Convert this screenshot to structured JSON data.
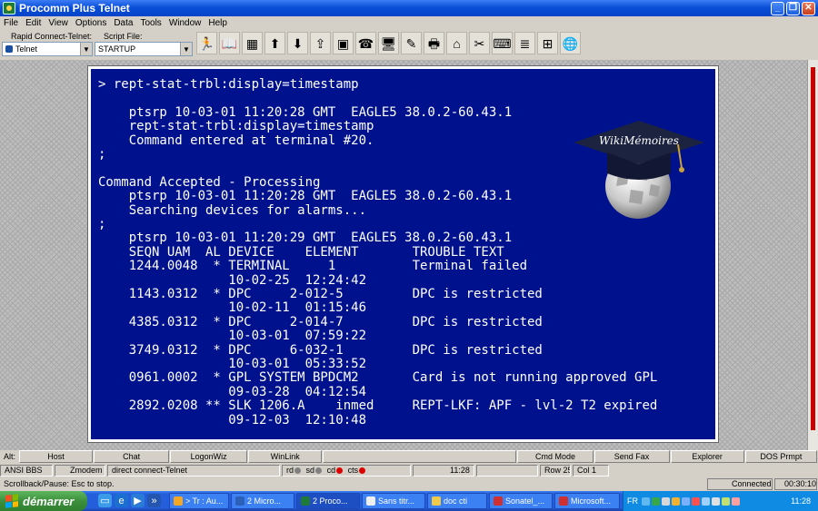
{
  "window": {
    "title": "Procomm Plus Telnet",
    "controls": {
      "minimize": "_",
      "maximize": "❐",
      "close": "✕"
    }
  },
  "menu": [
    "File",
    "Edit",
    "View",
    "Options",
    "Data",
    "Tools",
    "Window",
    "Help"
  ],
  "toolbar": {
    "rapid_connect_label": "Rapid Connect-Telnet:",
    "rapid_connect_value": "Telnet",
    "script_file_label": "Script File:",
    "script_file_value": "STARTUP",
    "icons": [
      {
        "name": "run-script-icon",
        "glyph": "🏃"
      },
      {
        "name": "dialing-directory-icon",
        "glyph": "📖"
      },
      {
        "name": "mode-icon",
        "glyph": "▦"
      },
      {
        "name": "send-file-icon",
        "glyph": "⬆"
      },
      {
        "name": "receive-file-icon",
        "glyph": "⬇"
      },
      {
        "name": "upload-icon",
        "glyph": "⇪"
      },
      {
        "name": "terminal-screen-icon",
        "glyph": "▣"
      },
      {
        "name": "phone-icon",
        "glyph": "☎"
      },
      {
        "name": "monitor-icon",
        "glyph": "🖥"
      },
      {
        "name": "clear-screen-icon",
        "glyph": "✎"
      },
      {
        "name": "print-icon",
        "glyph": "🖶"
      },
      {
        "name": "capture-icon",
        "glyph": "⌂"
      },
      {
        "name": "setup-icon",
        "glyph": "✂"
      },
      {
        "name": "chat-icon",
        "glyph": "⌨"
      },
      {
        "name": "notes-icon",
        "glyph": "≣"
      },
      {
        "name": "meta-keys-icon",
        "glyph": "⊞"
      },
      {
        "name": "internet-icon",
        "glyph": "🌐"
      }
    ]
  },
  "terminal": {
    "lines": [
      {
        "row": 0,
        "text": "> rept-stat-trbl:display=timestamp"
      },
      {
        "row": 2,
        "text": "    ptsrp 10-03-01 11:20:28 GMT  EAGLE5 38.0.2-60.43.1"
      },
      {
        "row": 3,
        "text": "    rept-stat-trbl:display=timestamp"
      },
      {
        "row": 4,
        "text": "    Command entered at terminal #20."
      },
      {
        "row": 5,
        "text": ";"
      },
      {
        "row": 7,
        "text": "Command Accepted - Processing"
      },
      {
        "row": 8,
        "text": "    ptsrp 10-03-01 11:20:28 GMT  EAGLE5 38.0.2-60.43.1"
      },
      {
        "row": 9,
        "text": "    Searching devices for alarms..."
      },
      {
        "row": 10,
        "text": ";"
      },
      {
        "row": 11,
        "text": "    ptsrp 10-03-01 11:20:29 GMT  EAGLE5 38.0.2-60.43.1"
      },
      {
        "row": 12,
        "text": "    SEQN UAM  AL DEVICE    ELEMENT       TROUBLE TEXT"
      },
      {
        "row": 13,
        "text": "    1244.0048  * TERMINAL     1          Terminal failed"
      },
      {
        "row": 14,
        "text": "                 10-02-25  12:24:42"
      },
      {
        "row": 15,
        "text": "    1143.0312  * DPC     2-012-5         DPC is restricted"
      },
      {
        "row": 16,
        "text": "                 10-02-11  01:15:46"
      },
      {
        "row": 17,
        "text": "    4385.0312  * DPC     2-014-7         DPC is restricted"
      },
      {
        "row": 18,
        "text": "                 10-03-01  07:59:22"
      },
      {
        "row": 19,
        "text": "    3749.0312  * DPC     6-032-1         DPC is restricted"
      },
      {
        "row": 20,
        "text": "                 10-03-01  05:33:52"
      },
      {
        "row": 21,
        "text": "    0961.0002  * GPL SYSTEM BPDCM2       Card is not running approved GPL"
      },
      {
        "row": 22,
        "text": "                 09-03-28  04:12:54"
      },
      {
        "row": 23,
        "text": "    2892.0208 ** SLK 1206.A    inmed     REPT-LKF: APF - lvl-2 T2 expired"
      },
      {
        "row": 24,
        "text": "                 09-12-03  12:10:48"
      }
    ]
  },
  "watermark": {
    "text": "WikiMémoires"
  },
  "fkeys": {
    "prefix": "Alt:",
    "keys": [
      "Host",
      "Chat",
      "LogonWiz",
      "WinLink",
      "",
      "Cmd Mode",
      "Send Fax",
      "Explorer",
      "DOS Prmpt"
    ]
  },
  "status": {
    "emulation": "ANSI BBS",
    "protocol": "Zmodem",
    "connection": "direct connect-Telnet",
    "leds": [
      {
        "label": "rd",
        "state": "grey"
      },
      {
        "label": "sd",
        "state": "grey"
      },
      {
        "label": "cd",
        "state": "red"
      },
      {
        "label": "cts",
        "state": "red"
      }
    ],
    "time": "11:28",
    "row": "Row 25",
    "col": "Col 1"
  },
  "status2": {
    "hint": "Scrollback/Pause: Esc to stop.",
    "connected": "Connected",
    "elapsed": "00:30:10"
  },
  "taskbar": {
    "start_label": "démarrer",
    "tasks": [
      {
        "label": "> Tr : Au...",
        "color": "#f5a623",
        "active": false
      },
      {
        "label": "2 Micro...",
        "color": "#2b5fb8",
        "active": false
      },
      {
        "label": "2 Proco...",
        "color": "#1f7a3a",
        "active": true
      },
      {
        "label": "Sans titr...",
        "color": "#eeeeee",
        "active": false
      },
      {
        "label": "doc cti",
        "color": "#f0c84a",
        "active": false
      },
      {
        "label": "Sonatel_...",
        "color": "#d03030",
        "active": false
      },
      {
        "label": "Microsoft...",
        "color": "#d03030",
        "active": false
      }
    ],
    "language": "FR",
    "clock": "11:28"
  }
}
